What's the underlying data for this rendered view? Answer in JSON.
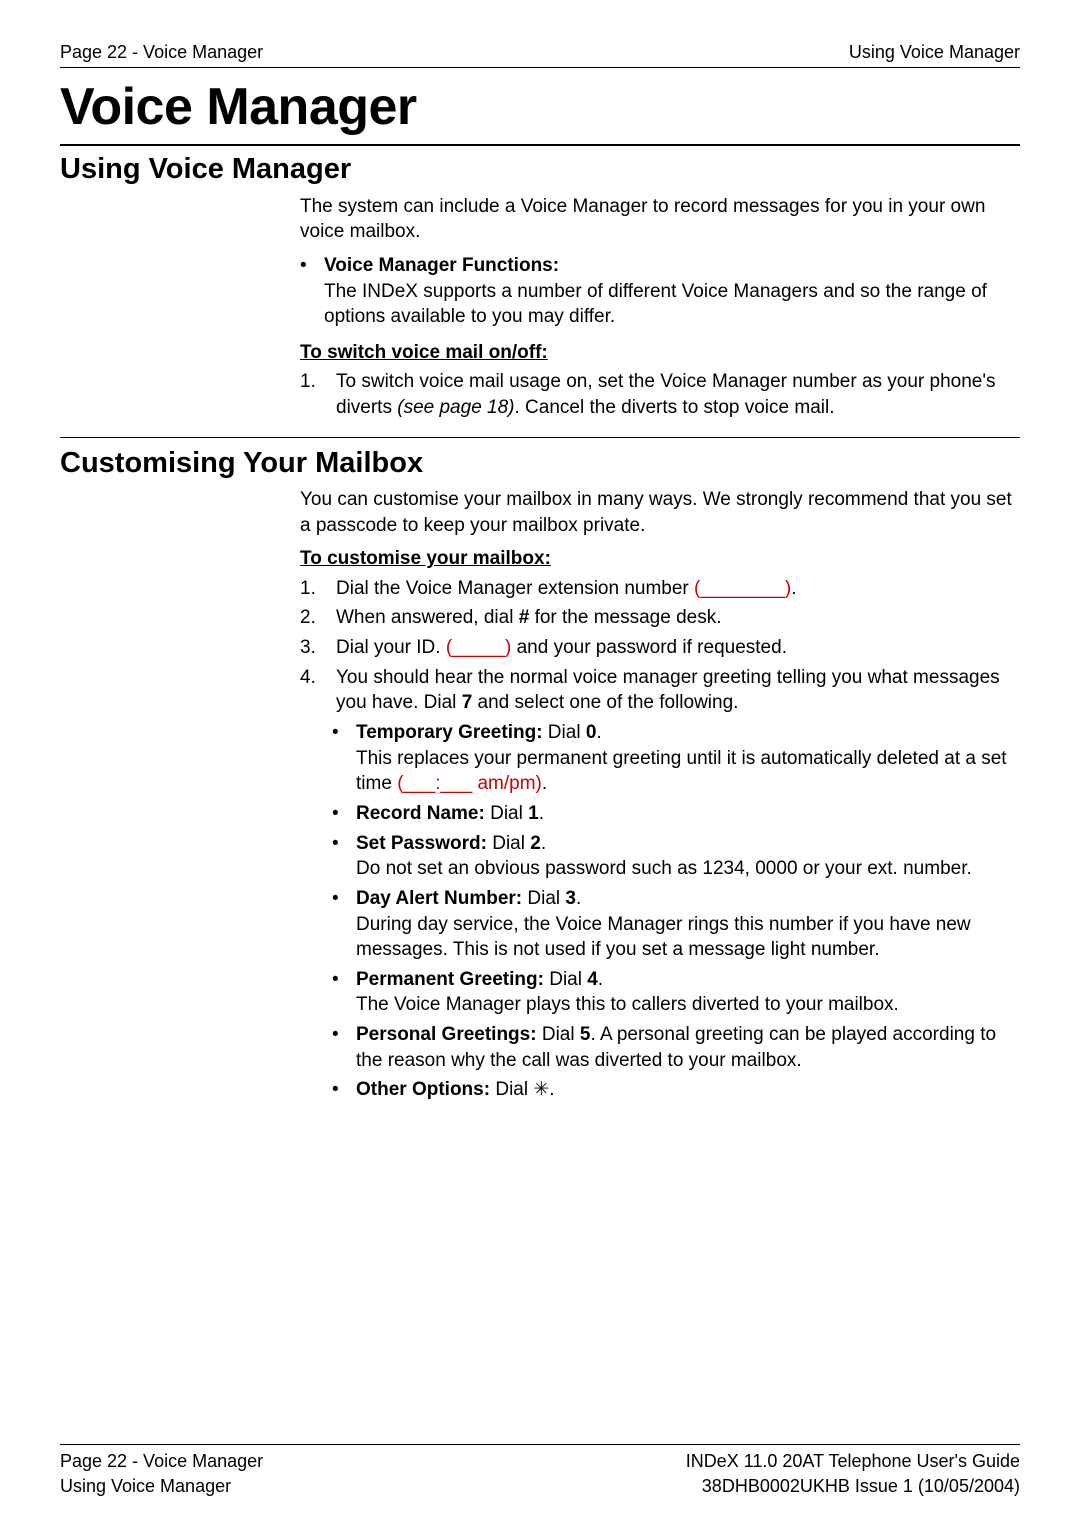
{
  "header": {
    "left": "Page 22 - Voice Manager",
    "right": "Using Voice Manager"
  },
  "title": "Voice Manager",
  "sections": {
    "s1": {
      "heading": "Using Voice Manager",
      "intro": "The system can include a Voice Manager to record messages for you in your own voice mailbox.",
      "functions_label": "Voice Manager Functions:",
      "functions_text": "The INDeX supports a number of different Voice Managers and so the range of options available to you may differ.",
      "switch_heading": "To switch voice mail on/off:",
      "switch_num": "1.",
      "switch_text_pre": "To switch voice mail usage on, set the Voice Manager number as your phone's diverts ",
      "switch_text_italic": "(see page 18)",
      "switch_text_post": ". Cancel the diverts to stop voice mail."
    },
    "s2": {
      "heading": "Customising Your Mailbox",
      "intro": "You can customise your mailbox in many ways. We strongly recommend that you set a passcode to keep your mailbox private.",
      "custom_heading": "To customise your mailbox:",
      "steps": {
        "n1": "1.",
        "t1a": "Dial the Voice Manager extension number ",
        "t1b": "(________)",
        "t1c": ".",
        "n2": "2.",
        "t2a": "When answered, dial ",
        "t2b": "#",
        "t2c": " for the message desk.",
        "n3": "3.",
        "t3a": "Dial your ID. ",
        "t3b": "(_____)",
        "t3c": " and your password if requested.",
        "n4": "4.",
        "t4a": "You should hear the normal voice manager greeting telling you what messages you have. Dial ",
        "t4b": "7",
        "t4c": " and select one of the following."
      },
      "opts": {
        "o1l": "Temporary Greeting:",
        "o1d": " Dial ",
        "o1n": "0",
        "o1p": ".",
        "o1t1": "This replaces your permanent greeting until it is automatically deleted at a set time ",
        "o1t2": "(___:___ am/pm)",
        "o1t3": ".",
        "o2l": "Record Name:",
        "o2d": " Dial ",
        "o2n": "1",
        "o2p": ".",
        "o3l": "Set Password:",
        "o3d": " Dial ",
        "o3n": "2",
        "o3p": ".",
        "o3t": "Do not set an obvious password such as 1234, 0000 or your ext. number.",
        "o4l": "Day Alert Number:",
        "o4d": " Dial ",
        "o4n": "3",
        "o4p": ".",
        "o4t": "During day service, the Voice Manager rings this number if you have new messages. This is not used if you set a message light number.",
        "o5l": "Permanent Greeting:",
        "o5d": " Dial ",
        "o5n": "4",
        "o5p": ".",
        "o5t": "The Voice Manager plays this to callers diverted to your mailbox.",
        "o6l": "Personal Greetings:",
        "o6d": " Dial ",
        "o6n": "5",
        "o6p": ". A personal greeting can be played according to the reason why the call was diverted to your mailbox.",
        "o7l": "Other Options:",
        "o7d": " Dial ",
        "o7n": "✳",
        "o7p": "."
      }
    }
  },
  "footer": {
    "left1": "Page 22 - Voice Manager",
    "left2": "Using Voice Manager",
    "right1": "INDeX 11.0 20AT Telephone User's Guide",
    "right2": "38DHB0002UKHB Issue 1 (10/05/2004)"
  },
  "bullet": "•"
}
